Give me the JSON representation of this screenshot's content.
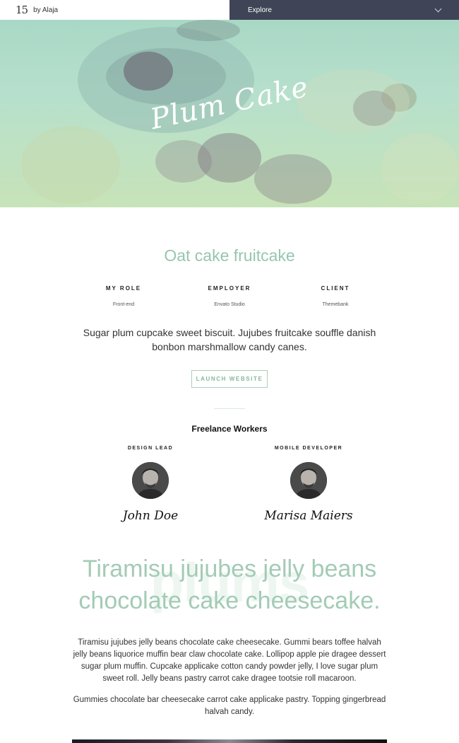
{
  "header": {
    "logo": "15",
    "byline": "by Alaja",
    "explore_label": "Explore"
  },
  "hero": {
    "title": "Plum Cake"
  },
  "project": {
    "title": "Oat cake fruitcake",
    "meta": [
      {
        "label": "MY ROLE",
        "value": "Front-end"
      },
      {
        "label": "EMPLOYER",
        "value": "Envato Studio"
      },
      {
        "label": "CLIENT",
        "value": "Themebank"
      }
    ],
    "lead": "Sugar plum cupcake sweet biscuit. Jujubes fruitcake souffle danish bonbon marshmallow candy canes.",
    "launch_label": "LAUNCH WEBSITE"
  },
  "workers": {
    "title": "Freelance Workers",
    "people": [
      {
        "role": "DESIGN LEAD",
        "name": "John Doe"
      },
      {
        "role": "MOBILE DEVELOPER",
        "name": "Marisa Maiers"
      }
    ]
  },
  "feature": {
    "watermark": "plums",
    "headline_line1": "Tiramisu jujubes jelly beans",
    "headline_line2": "chocolate cake cheesecake.",
    "paragraph1": "Tiramisu jujubes jelly beans chocolate cake cheesecake. Gummi bears toffee halvah jelly beans liquorice muffin bear claw chocolate cake. Lollipop apple pie dragee dessert sugar plum muffin. Cupcake applicake cotton candy powder jelly, I love sugar plum sweet roll. Jelly beans pastry carrot cake dragee tootsie roll macaroon.",
    "paragraph2": "Gummies chocolate bar cheesecake carrot cake applicake pastry. Topping gingerbread halvah candy."
  },
  "colors": {
    "accent": "#96c6ad",
    "header_dark": "#3f4557"
  }
}
